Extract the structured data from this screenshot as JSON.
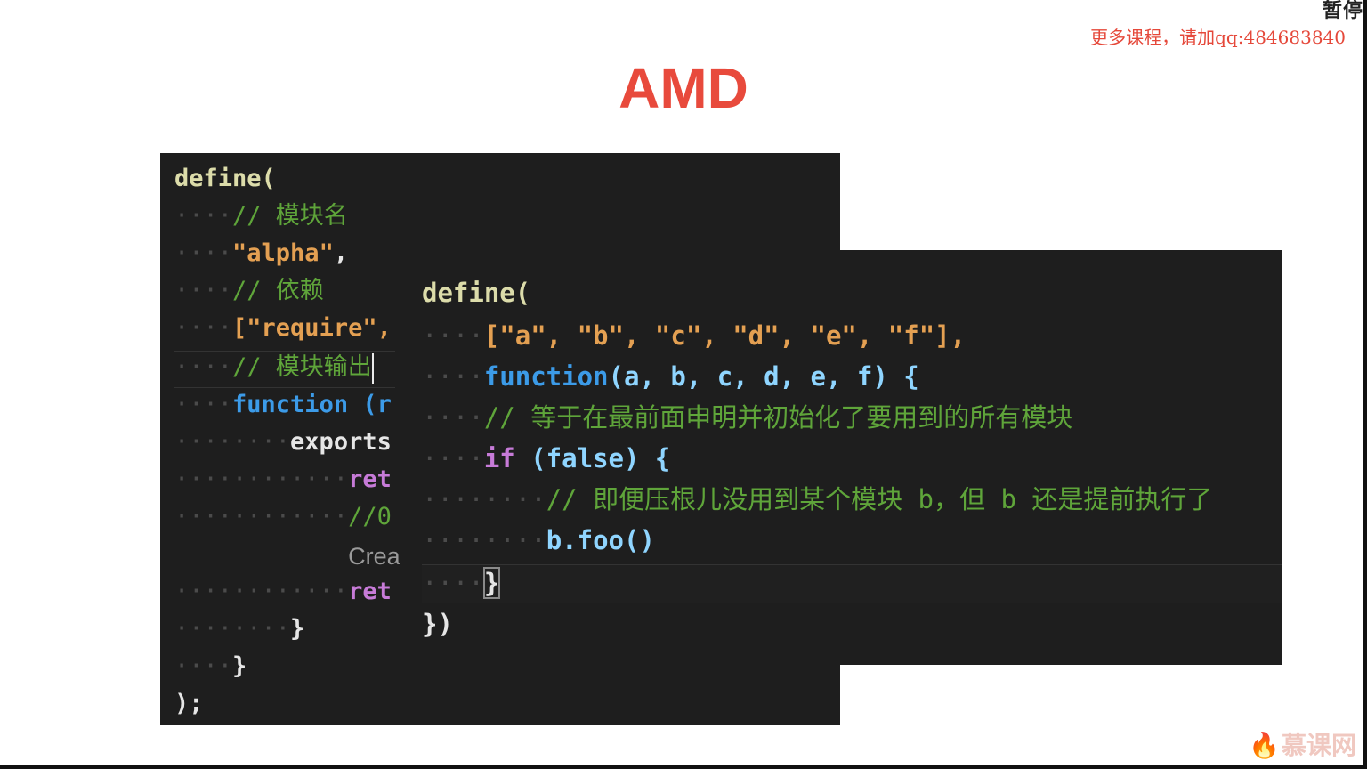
{
  "overlay": {
    "pause_label": "暂停",
    "promo_text": "更多课程，请加qq:484683840",
    "logo_text": "慕课网"
  },
  "slide": {
    "title": "AMD"
  },
  "back_code": {
    "l1": "define(",
    "l2_comment": "// 模块名",
    "l3_string": "\"alpha\"",
    "l4_comment": "// 依赖",
    "l5": "[\"require\",",
    "l6_comment": "// 模块输出",
    "l7_kw": "function",
    "l7_rest": " (r",
    "l8": "exports",
    "l9": "ret",
    "l10": "//0",
    "l11": "Crea",
    "l12": "ret",
    "l13": "}",
    "l14": "}",
    "l15": ");"
  },
  "front_code": {
    "l1": "define(",
    "l2": "[\"a\", \"b\", \"c\", \"d\", \"e\", \"f\"],",
    "l3_kw": "function",
    "l3_rest": "(a, b, c, d, e, f) {",
    "l4_comment": "// 等于在最前面申明并初始化了要用到的所有模块",
    "l5_kw": "if",
    "l5_rest": " (false) {",
    "l6_comment": "// 即便压根儿没用到某个模块 b，但 b 还是提前执行了",
    "l7": "b.foo()",
    "l8": "}",
    "l9": "})"
  },
  "colors": {
    "title_red": "#e84a3c",
    "editor_bg": "#1e1e1e",
    "comment_green": "#5fa53a",
    "keyword_blue": "#3c9be8",
    "string_orange": "#e4a052",
    "function_yellow": "#dcdcaa"
  }
}
